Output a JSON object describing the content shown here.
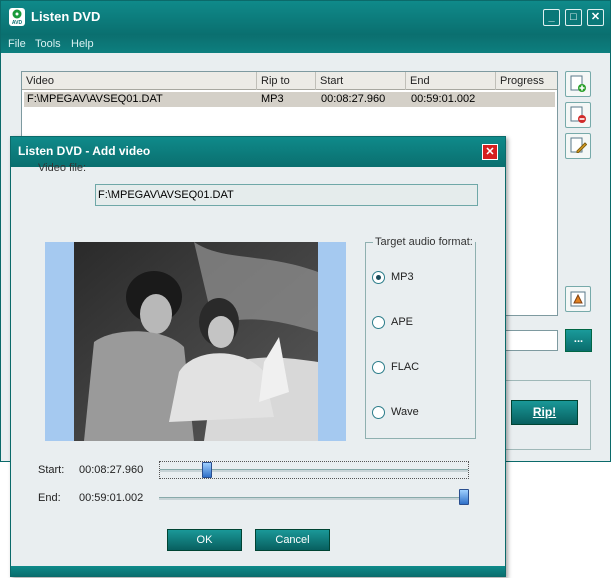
{
  "main": {
    "title": "Listen DVD",
    "menu": [
      "File",
      "Tools",
      "Help"
    ],
    "controls": {
      "minimize": "_",
      "maximize": "□",
      "close": "✕"
    },
    "table": {
      "columns": [
        "Video",
        "Rip to",
        "Start",
        "End",
        "Progress"
      ],
      "rows": [
        {
          "video": "F:\\MPEGAV\\AVSEQ01.DAT",
          "rip_to": "MP3",
          "start": "00:08:27.960",
          "end": "00:59:01.002",
          "progress": ""
        }
      ]
    },
    "side_buttons": [
      "add-icon",
      "remove-icon",
      "edit-icon",
      "settings-icon"
    ],
    "browse_label": "...",
    "rip_label": "Rip!"
  },
  "dialog": {
    "title": "Listen DVD - Add video",
    "close": "✕",
    "video_file_label": "Video file:",
    "video_file_value": "F:\\MPEGAV\\AVSEQ01.DAT",
    "audio_format": {
      "title": "Target audio format:",
      "options": [
        "MP3",
        "APE",
        "FLAC",
        "Wave"
      ],
      "selected": "MP3"
    },
    "start_label": "Start:",
    "start_time": "00:08:27.960",
    "end_label": "End:",
    "end_time": "00:59:01.002",
    "start_fraction": 0.14,
    "end_fraction": 1.0,
    "ok_label": "OK",
    "cancel_label": "Cancel"
  },
  "colors": {
    "titlebar": "#0a7878",
    "preview_background": "#a5c9f0",
    "close_button": "#d62020"
  }
}
